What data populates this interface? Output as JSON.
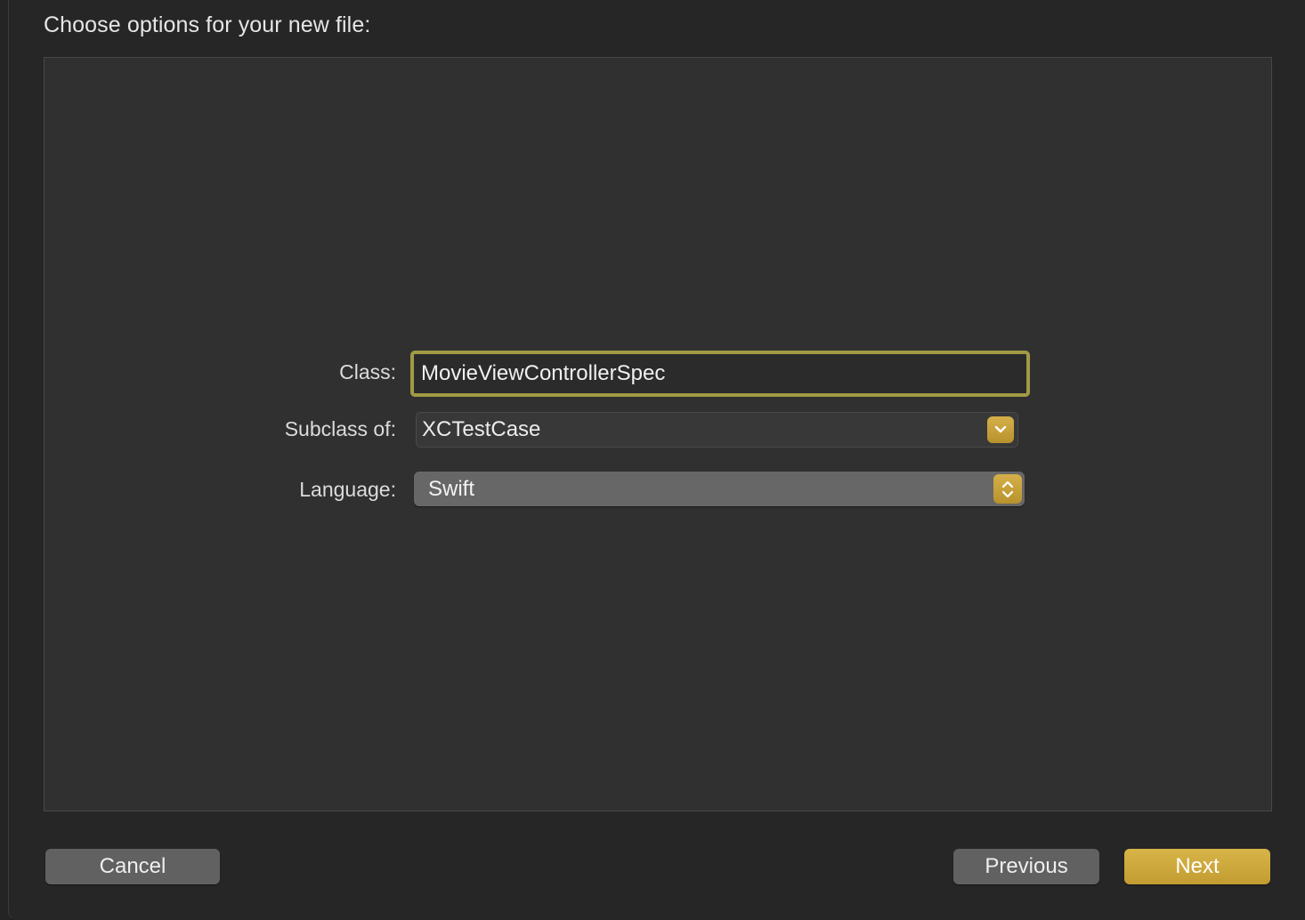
{
  "dialog": {
    "heading": "Choose options for your new file:"
  },
  "form": {
    "class_label": "Class:",
    "class_value": "MovieViewControllerSpec",
    "subclass_label": "Subclass of:",
    "subclass_value": "XCTestCase",
    "language_label": "Language:",
    "language_value": "Swift"
  },
  "buttons": {
    "cancel": "Cancel",
    "previous": "Previous",
    "next": "Next"
  },
  "colors": {
    "accent": "#c9a53a",
    "focus_ring": "#a19a45",
    "panel": "#303030",
    "sheet": "#262626"
  },
  "icons": {
    "subclass_dropdown": "chevron-down-icon",
    "language_popup": "up-down-chevrons-icon"
  }
}
